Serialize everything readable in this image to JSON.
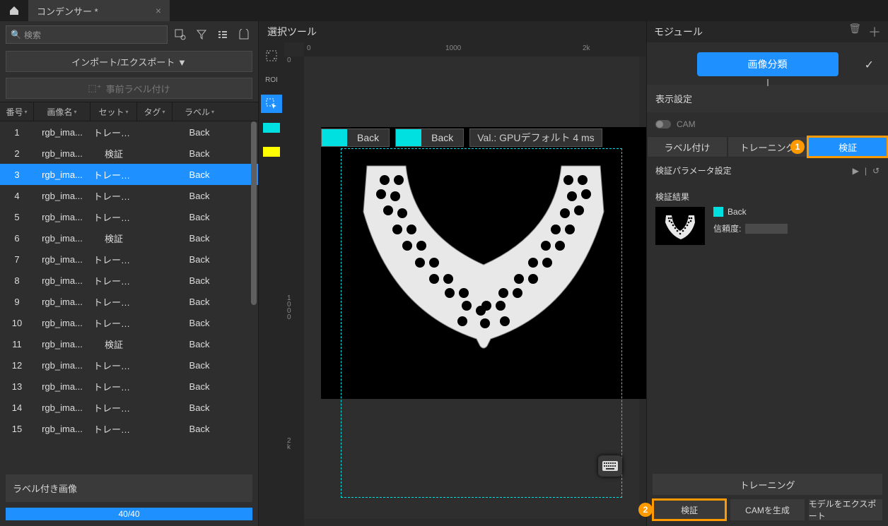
{
  "titlebar": {
    "tab_title": "コンデンサー *"
  },
  "left": {
    "search_placeholder": "検索",
    "import_export": "インポート/エクスポート ▼",
    "prelabel": "事前ラベル付け",
    "headers": {
      "num": "番号",
      "name": "画像名",
      "set": "セット",
      "tag": "タグ",
      "label": "ラベル"
    },
    "rows": [
      {
        "n": "1",
        "name": "rgb_ima...",
        "set": "トレーニ...",
        "label": "Back",
        "sel": false
      },
      {
        "n": "2",
        "name": "rgb_ima...",
        "set": "検証",
        "label": "Back",
        "sel": false
      },
      {
        "n": "3",
        "name": "rgb_ima...",
        "set": "トレーニ...",
        "label": "Back",
        "sel": true
      },
      {
        "n": "4",
        "name": "rgb_ima...",
        "set": "トレーニ...",
        "label": "Back",
        "sel": false
      },
      {
        "n": "5",
        "name": "rgb_ima...",
        "set": "トレーニ...",
        "label": "Back",
        "sel": false
      },
      {
        "n": "6",
        "name": "rgb_ima...",
        "set": "検証",
        "label": "Back",
        "sel": false
      },
      {
        "n": "7",
        "name": "rgb_ima...",
        "set": "トレーニ...",
        "label": "Back",
        "sel": false
      },
      {
        "n": "8",
        "name": "rgb_ima...",
        "set": "トレーニ...",
        "label": "Back",
        "sel": false
      },
      {
        "n": "9",
        "name": "rgb_ima...",
        "set": "トレーニ...",
        "label": "Back",
        "sel": false
      },
      {
        "n": "10",
        "name": "rgb_ima...",
        "set": "トレーニ...",
        "label": "Back",
        "sel": false
      },
      {
        "n": "11",
        "name": "rgb_ima...",
        "set": "検証",
        "label": "Back",
        "sel": false
      },
      {
        "n": "12",
        "name": "rgb_ima...",
        "set": "トレーニ...",
        "label": "Back",
        "sel": false
      },
      {
        "n": "13",
        "name": "rgb_ima...",
        "set": "トレーニ...",
        "label": "Back",
        "sel": false
      },
      {
        "n": "14",
        "name": "rgb_ima...",
        "set": "トレーニ...",
        "label": "Back",
        "sel": false
      },
      {
        "n": "15",
        "name": "rgb_ima...",
        "set": "トレーニ...",
        "label": "Back",
        "sel": false
      }
    ],
    "labeled_images": "ラベル付き画像",
    "progress_text": "40/40"
  },
  "center": {
    "title": "選択ツール",
    "roi_label": "ROI",
    "ruler_h": {
      "t0": "0",
      "t1": "1000",
      "t2": "2k"
    },
    "ruler_v": {
      "t0": "0",
      "t1": "1\n0\n0\n0",
      "t2": "2\nk"
    },
    "chip1": "Back",
    "chip2": "Back",
    "val": "Val.:   GPUデフォルト 4 ms"
  },
  "right": {
    "module": "モジュール",
    "image_classify": "画像分類",
    "display_settings": "表示設定",
    "cam": "CAM",
    "tabs": {
      "label": "ラベル付け",
      "train": "トレーニング",
      "verify": "検証"
    },
    "param_title": "検証パラメータ設定",
    "result_title": "検証結果",
    "result_label": "Back",
    "confidence": "信頼度:",
    "training_btn": "トレーニング",
    "bottom": {
      "verify": "検証",
      "cam": "CAMを生成",
      "export": "モデルをエクスポート"
    },
    "callout1": "1",
    "callout2": "2"
  }
}
